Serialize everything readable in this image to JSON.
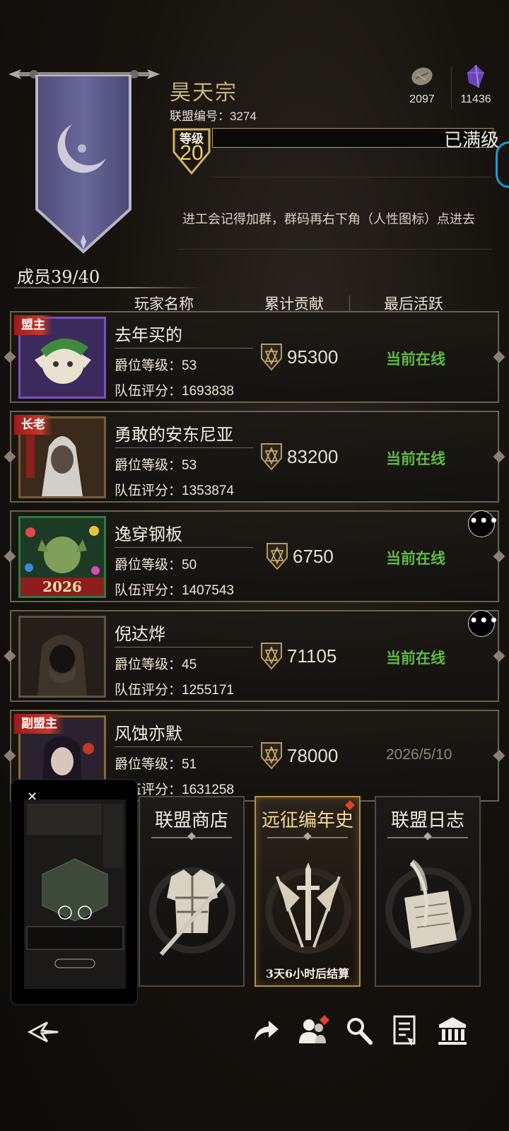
{
  "guild": {
    "name": "昊天宗",
    "id_label": "联盟编号：",
    "id_value": "3274",
    "level_label": "等级",
    "level_value": "20",
    "level_status": "已满级",
    "notice": "进工会记得加群，群码再右下角（人性图标）点进去",
    "members_label": "成员39/40"
  },
  "currencies": [
    {
      "icon": "ore-icon",
      "value": "2097"
    },
    {
      "icon": "crystal-icon",
      "value": "11436"
    }
  ],
  "columns": {
    "name": "玩家名称",
    "contribution": "累计贡献",
    "last_active": "最后活跃"
  },
  "labels": {
    "rank": "爵位等级：",
    "score": "队伍评分："
  },
  "members": [
    {
      "role": "盟主",
      "name": "去年买的",
      "rank": "53",
      "score": "1693838",
      "contribution": "95300",
      "status": "当前在线",
      "online": true,
      "more": false
    },
    {
      "role": "长老",
      "name": "勇敢的安东尼亚",
      "rank": "53",
      "score": "1353874",
      "contribution": "83200",
      "status": "当前在线",
      "online": true,
      "more": false
    },
    {
      "role": "",
      "name": "逸穿钢板",
      "rank": "50",
      "score": "1407543",
      "contribution": "6750",
      "status": "当前在线",
      "online": true,
      "more": true
    },
    {
      "role": "",
      "name": "倪达烨",
      "rank": "45",
      "score": "1255171",
      "contribution": "71105",
      "status": "当前在线",
      "online": true,
      "more": true
    },
    {
      "role": "副盟主",
      "name": "风蚀亦默",
      "rank": "51",
      "score": "1631258",
      "contribution": "78000",
      "status": "2026/5/10",
      "online": false,
      "more": false
    }
  ],
  "avatar_badge": "2026",
  "more_glyph": "•••",
  "cards": [
    {
      "title": "联盟商店",
      "subtitle": "",
      "icon": "armor-icon"
    },
    {
      "title": "远征编年史",
      "subtitle": "3天6小时后结算",
      "icon": "crossed-banners-icon"
    },
    {
      "title": "联盟日志",
      "subtitle": "",
      "icon": "scroll-quill-icon"
    }
  ],
  "preview": {
    "close_glyph": "✕"
  },
  "nav": [
    "back-icon",
    "share-icon",
    "members-icon",
    "search-icon",
    "document-icon",
    "bank-icon"
  ],
  "colors": {
    "online": "#5fba45",
    "gold": "#c8b27a",
    "accent_red": "#c23a2a"
  }
}
